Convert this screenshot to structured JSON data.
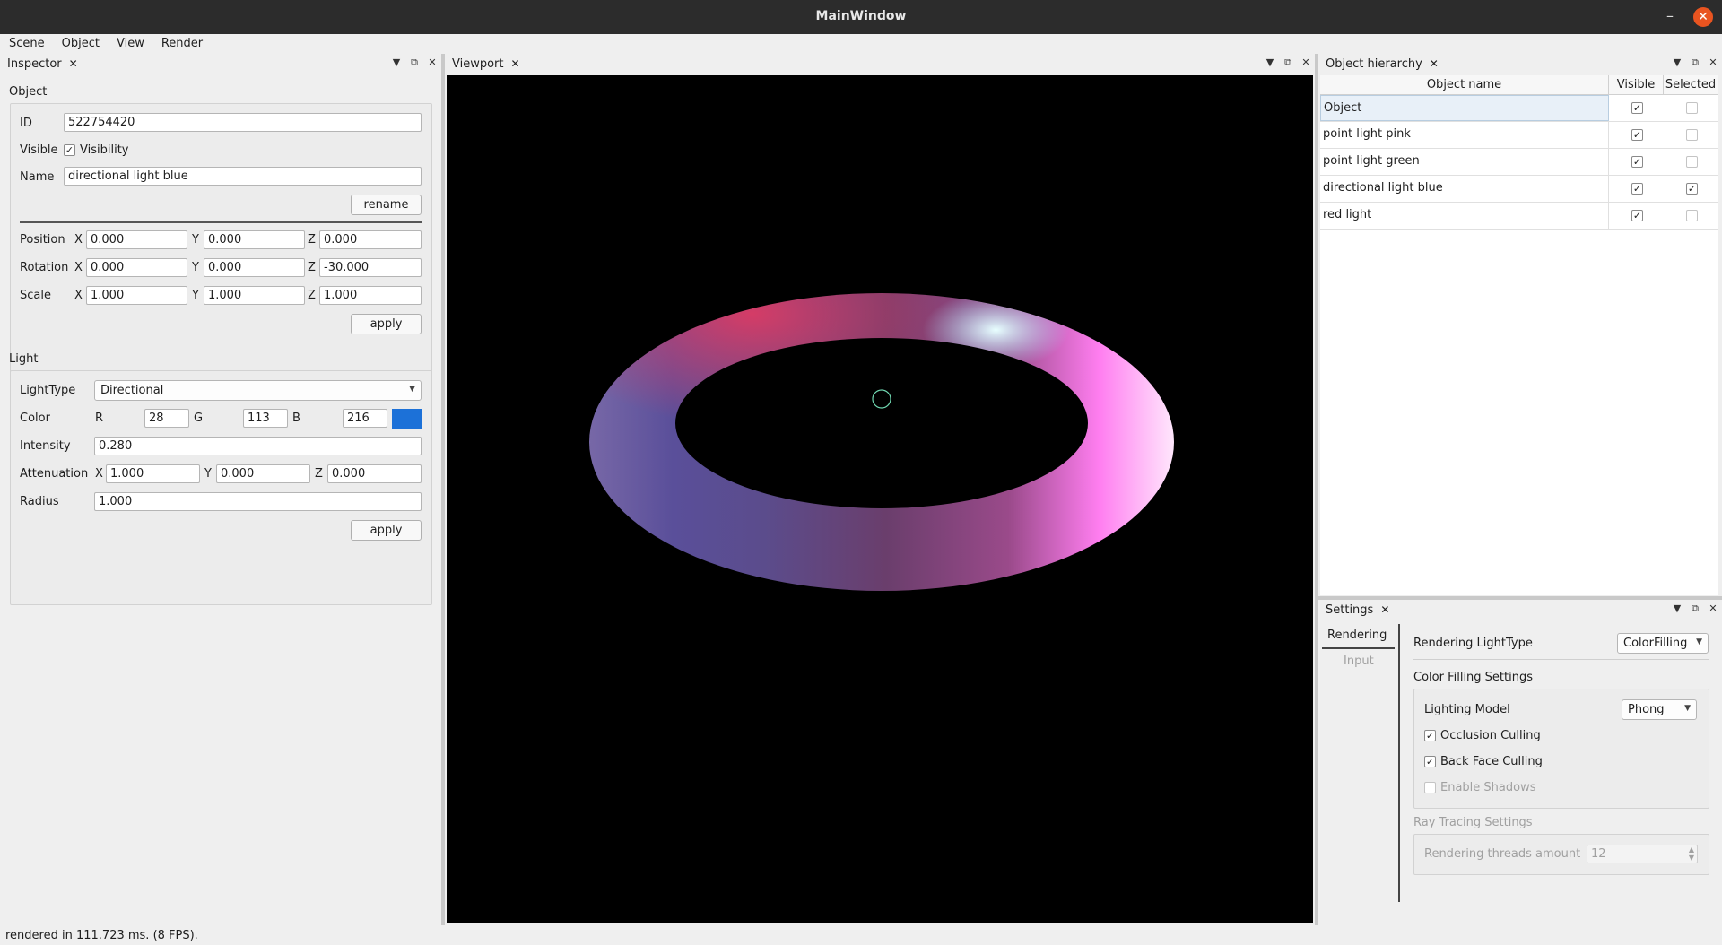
{
  "window": {
    "title": "MainWindow"
  },
  "menu": [
    "Scene",
    "Object",
    "View",
    "Render"
  ],
  "inspector": {
    "title": "Inspector",
    "object_section": "Object",
    "id_label": "ID",
    "id_value": "522754420",
    "visible_label": "Visible",
    "visibility_label": "Visibility",
    "visibility_checked": true,
    "name_label": "Name",
    "name_value": "directional light blue",
    "rename_label": "rename",
    "position_label": "Position",
    "rotation_label": "Rotation",
    "scale_label": "Scale",
    "axis": {
      "x": "X",
      "y": "Y",
      "z": "Z"
    },
    "position": {
      "x": "0.000",
      "y": "0.000",
      "z": "0.000"
    },
    "rotation": {
      "x": "0.000",
      "y": "0.000",
      "z": "-30.000"
    },
    "scale": {
      "x": "1.000",
      "y": "1.000",
      "z": "1.000"
    },
    "apply_label": "apply",
    "light_section": "Light",
    "lighttype_label": "LightType",
    "lighttype_value": "Directional",
    "color_label": "Color",
    "color_r_label": "R",
    "color_g_label": "G",
    "color_b_label": "B",
    "color_r": "28",
    "color_g": "113",
    "color_b": "216",
    "color_swatch": "#1c71d8",
    "intensity_label": "Intensity",
    "intensity_value": "0.280",
    "attenuation_label": "Attenuation",
    "attenuation": {
      "x": "1.000",
      "y": "0.000",
      "z": "0.000"
    },
    "radius_label": "Radius",
    "radius_value": "1.000",
    "apply2_label": "apply"
  },
  "viewport": {
    "title": "Viewport"
  },
  "hierarchy": {
    "title": "Object hierarchy",
    "columns": [
      "Object name",
      "Visible",
      "Selected"
    ],
    "rows": [
      {
        "name": "Object",
        "visible": true,
        "selected": false
      },
      {
        "name": "point light pink",
        "visible": true,
        "selected": false
      },
      {
        "name": "point light green",
        "visible": true,
        "selected": false
      },
      {
        "name": "directional light blue",
        "visible": true,
        "selected": true
      },
      {
        "name": "red light",
        "visible": true,
        "selected": false
      }
    ]
  },
  "settings": {
    "title": "Settings",
    "tabs": [
      "Rendering",
      "Input"
    ],
    "rendering_lighttype_label": "Rendering LightType",
    "rendering_lighttype_value": "ColorFilling",
    "color_filling_label": "Color Filling Settings",
    "lighting_model_label": "Lighting Model",
    "lighting_model_value": "Phong",
    "occlusion_culling_label": "Occlusion Culling",
    "occlusion_culling": true,
    "back_face_culling_label": "Back Face Culling",
    "back_face_culling": true,
    "enable_shadows_label": "Enable Shadows",
    "enable_shadows": false,
    "ray_tracing_label": "Ray Tracing Settings",
    "threads_label": "Rendering threads amount",
    "threads_value": "12"
  },
  "status": {
    "text": "rendered in 111.723 ms. (8 FPS)."
  },
  "colors": {
    "accent_close": "#e95420",
    "viewport_bg": "#000000",
    "selection_row": "#e8f0f8"
  },
  "icons": [
    "close-icon",
    "minimize-icon",
    "dock-menu-icon",
    "dock-float-icon",
    "dock-close-icon",
    "checkmark-icon",
    "dropdown-arrow-icon",
    "spin-arrows-icon"
  ]
}
